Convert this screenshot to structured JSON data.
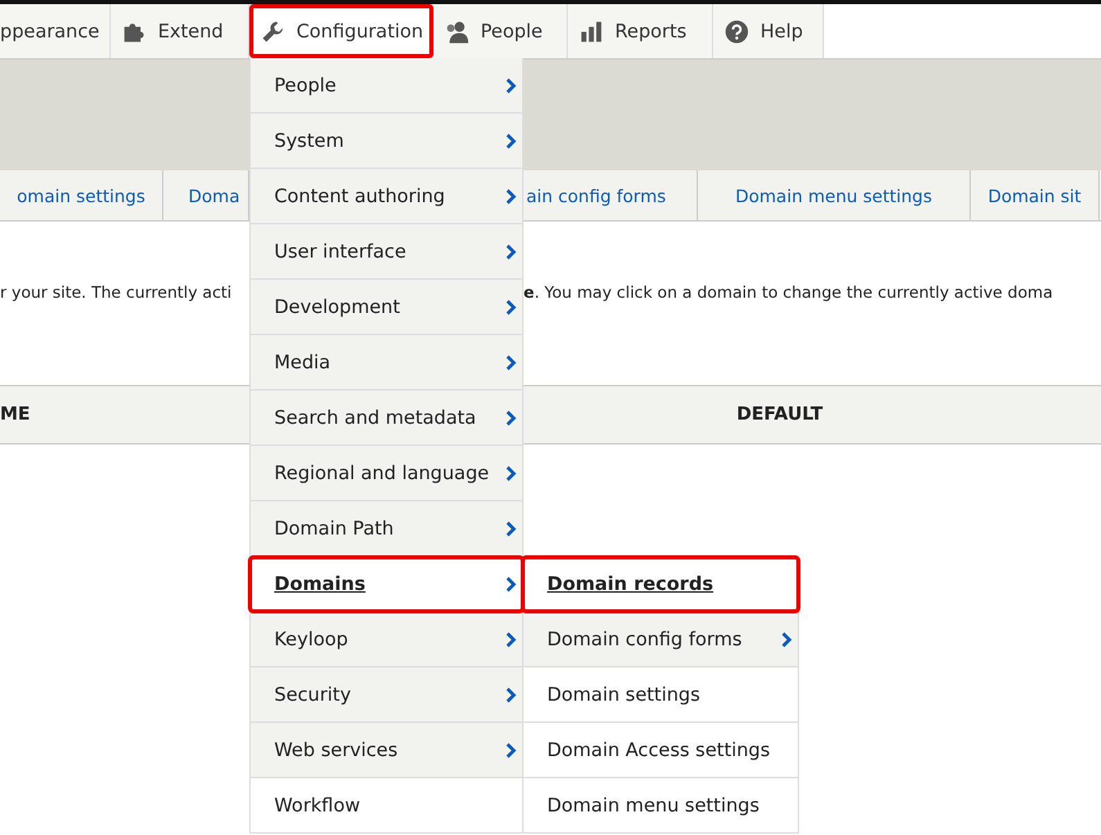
{
  "toolbar": [
    {
      "label": "ppearance",
      "highlighted": false
    },
    {
      "label": "Extend",
      "highlighted": false
    },
    {
      "label": "Configuration",
      "highlighted": true
    },
    {
      "label": "People",
      "highlighted": false
    },
    {
      "label": "Reports",
      "highlighted": false
    },
    {
      "label": "Help",
      "highlighted": false
    }
  ],
  "tabs": [
    {
      "label": "omain settings"
    },
    {
      "label": "Doma"
    },
    {
      "label": "ain config forms"
    },
    {
      "label": "Domain menu settings"
    },
    {
      "label": "Domain sit"
    }
  ],
  "description": {
    "left": "r your site. The currently acti",
    "right": "**e**. You may click on a domain to change the currently active doma"
  },
  "table": {
    "columns": [
      "ME",
      "DEFAULT"
    ]
  },
  "menu": [
    {
      "label": "People",
      "has_children": true,
      "highlighted": false
    },
    {
      "label": "System",
      "has_children": true,
      "highlighted": false
    },
    {
      "label": "Content authoring",
      "has_children": true,
      "highlighted": false
    },
    {
      "label": "User interface",
      "has_children": true,
      "highlighted": false
    },
    {
      "label": "Development",
      "has_children": true,
      "highlighted": false
    },
    {
      "label": "Media",
      "has_children": true,
      "highlighted": false
    },
    {
      "label": "Search and metadata",
      "has_children": true,
      "highlighted": false
    },
    {
      "label": "Regional and language",
      "has_children": true,
      "highlighted": false
    },
    {
      "label": "Domain Path",
      "has_children": true,
      "highlighted": false
    },
    {
      "label": "Domains",
      "has_children": true,
      "highlighted": true
    },
    {
      "label": "Keyloop",
      "has_children": true,
      "highlighted": false
    },
    {
      "label": "Security",
      "has_children": true,
      "highlighted": false
    },
    {
      "label": "Web services",
      "has_children": true,
      "highlighted": false
    },
    {
      "label": "Workflow",
      "has_children": false,
      "highlighted": false
    }
  ],
  "submenu": [
    {
      "label": "Domain records",
      "has_children": false,
      "highlighted": true
    },
    {
      "label": "Domain config forms",
      "has_children": true,
      "highlighted": false
    },
    {
      "label": "Domain settings",
      "has_children": false,
      "highlighted": false
    },
    {
      "label": "Domain Access settings",
      "has_children": false,
      "highlighted": false
    },
    {
      "label": "Domain menu settings",
      "has_children": false,
      "highlighted": false
    }
  ]
}
